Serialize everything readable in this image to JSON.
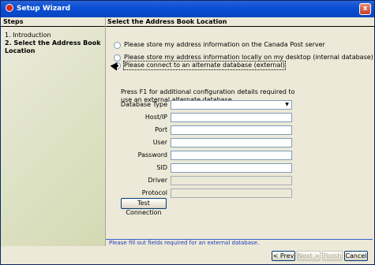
{
  "window": {
    "title": "Setup Wizard",
    "close_glyph": "x"
  },
  "steps": {
    "header": "Steps",
    "items": [
      {
        "label": "1. Introduction"
      },
      {
        "label": "2. Select the Address Book Location"
      }
    ]
  },
  "main": {
    "header": "Select the Address Book Location",
    "options": [
      {
        "label": "Please store my address information on the Canada Post server",
        "checked": false
      },
      {
        "label": "Please store my address information locally on my desktop (internal database)",
        "checked": false
      },
      {
        "label": "Please connect to an alternate database (external)",
        "checked": true
      }
    ],
    "info_text": "Press F1 for additional configuration details required to use an external alternate database.",
    "fields": [
      {
        "label": "Database Type",
        "value": "",
        "enabled": true,
        "dropdown": true
      },
      {
        "label": "Host/IP",
        "value": "",
        "enabled": true
      },
      {
        "label": "Port",
        "value": "",
        "enabled": true
      },
      {
        "label": "User",
        "value": "",
        "enabled": true
      },
      {
        "label": "Password",
        "value": "",
        "enabled": true
      },
      {
        "label": "SID",
        "value": "",
        "enabled": true
      },
      {
        "label": "Driver",
        "value": "",
        "enabled": false
      },
      {
        "label": "Protocol",
        "value": "",
        "enabled": false
      }
    ],
    "test_connection_label": "Test Connection",
    "status_text": "Please fill out fields required for an external database."
  },
  "footer": {
    "prev_label": "< Prev",
    "next_label": "Next >",
    "finish_label": "Finish",
    "cancel_label": "Cancel"
  },
  "colors": {
    "title_bar": "#0a4fd6",
    "status_text": "#1e3cb8"
  }
}
